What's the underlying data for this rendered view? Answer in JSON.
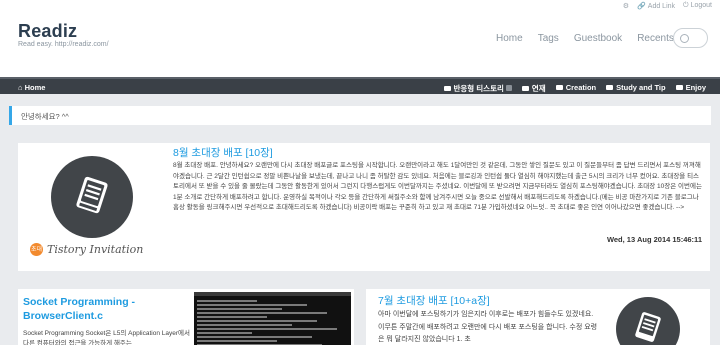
{
  "topbar": {
    "settings_icon": "gear-icon",
    "add_link": "Add Link",
    "logout": "Logout"
  },
  "site": {
    "name": "Readiz",
    "tagline": "Read easy. http://readiz.com/"
  },
  "main_nav": [
    "Home",
    "Tags",
    "Guestbook",
    "Recents"
  ],
  "search": {
    "icon": "search-icon",
    "placeholder": ""
  },
  "dark_nav": {
    "home": "Home",
    "categories": [
      "반응형 티스토리",
      "연재",
      "Creation",
      "Study and Tip",
      "Enjoy"
    ]
  },
  "notice": "안녕하세요? ^^",
  "posts": [
    {
      "title": "8월 초대장 배포 [10장]",
      "thumb_caption": "Tistory Invitation",
      "badge": "초대",
      "body": "8월 초대장 배포. 안녕하세요? 오랜만에 다시 초대장 배포글로 포스팅을 시작합니다. 오랜만이라고 해도 1달여만인 것 같은데, 그동안 쌓인 질문도 있고 이 질문들부터 좀 답변 드리면서 포스팅 꺼져해야겠습니다. 근 2달간 인턴쉽으로 정말 비쁜나날을 보냈는데, 끝나고 나니 좀 허탈한 감도 있네요. 처음에는 블로깅과 인턴쉽 둘다 열심히 해야지했는데 출근 5시의 크리가 너무 컸어요. 초대장을 티스토리에서 또 받을 수 있을 줄 몰랐는데 그동안 활동한게 있어서 그런지 다행스럽게도 이번달까지는 주셨네요. 이번달에 또 받으려면 지금부터라도 열심히 포스팅해야겠습니다. 초대장 10장은 이번에는 1분 소개로 간단하게 배포하려고 합니다. 운영하실 목적이나 각오 등을 간단하게 써질주소와 함께 남겨주시면 오늘 중으로 선발해서 배포해드리도록 하겠습니다.(메는 비공 마찬가지로 기존 블로그나 홈상 활동을 링크해주시면 우선적으로 초대해드리도록 하겠습니다) 비공이락 배포는 꾸준히 하고 있고 재 초대로 71분 가입하셨네요 어느덧.. 꼭 초대로 좋은 인연 이어나갔으면 좋겠습니다. -->",
      "date": "Wed, 13 Aug 2014 15:46:11"
    },
    {
      "title": "Socket Programming - BrowserClient.c",
      "body": "Socket Programming Socket은 L5의 Application Layer에서 다른 컴퓨터와의 접근을 가능하게 해주는"
    },
    {
      "title": "7월 초대장 배포 [10+a장]",
      "body": "아마 이번달에 포스팅하기가 임은지라 이후로는 배포가 힘들수도 있겠네요. 이무튼 주말간에 배포하려고 오랜만에 다시 배포 포스팅을 합니다. 수정 요령은 뭐 달라지진 않았습니다 1. 초"
    }
  ],
  "colors": {
    "accent": "#1e9be0",
    "notice_bar": "#35a7e8",
    "dark_nav": "#3a4047",
    "page_bg": "#e9ebee"
  }
}
